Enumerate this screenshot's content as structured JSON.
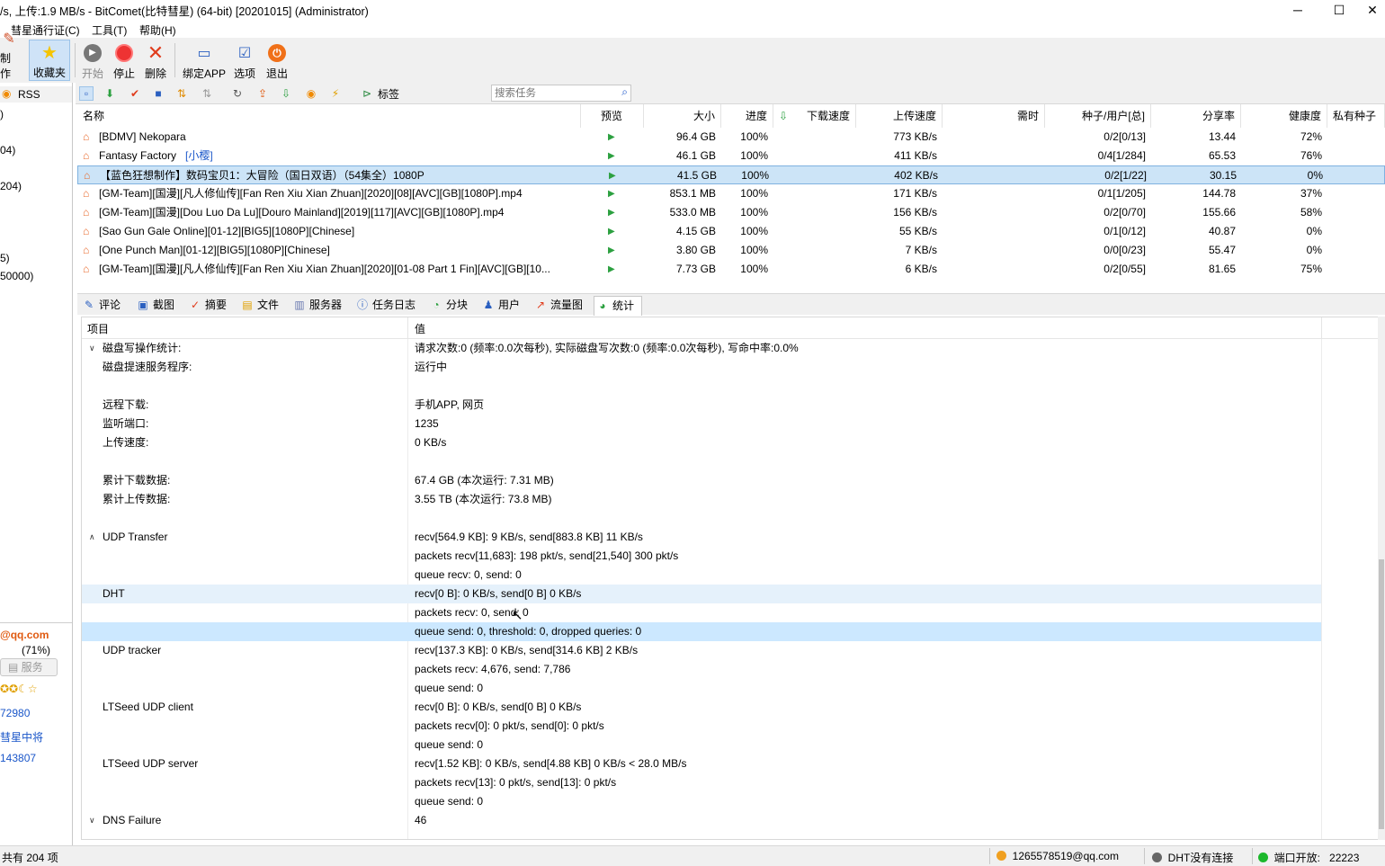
{
  "window": {
    "title": "/s, 上传:1.9 MB/s - BitComet(比特彗星) (64-bit) [20201015] (Administrator)",
    "minimize": "─",
    "maximize": "☐",
    "close": "✕"
  },
  "menu": [
    "彗星通行证(C)",
    "工具(T)",
    "帮助(H)"
  ],
  "toolbar": {
    "make": "制作",
    "favorites": "收藏夹",
    "start": "开始",
    "stop": "停止",
    "delete": "删除",
    "bind_app": "绑定APP",
    "options": "选项",
    "exit": "退出"
  },
  "left": {
    "rss": "RSS",
    "frag1": ")",
    "frag2": "04)",
    "frag3": "204)",
    "frag4": "5)",
    "frag5": "50000)",
    "email": "@qq.com",
    "percent": "(71%)",
    "service": "服务",
    "stars": "✪✪☾☆",
    "num1": "72980",
    "rank": "彗星中将",
    "num2": "143807"
  },
  "toolbar2": {
    "tag_label": "标签",
    "search_placeholder": "搜索任务"
  },
  "columns": [
    "名称",
    "预览",
    "大小",
    "进度",
    "下载速度",
    "上传速度",
    "需时",
    "种子/用户[总]",
    "分享率",
    "健康度",
    "私有种子"
  ],
  "torrents": [
    {
      "name": "[BDMV] Nekopara",
      "tag": "",
      "size": "96.4 GB",
      "progress": "100%",
      "up": "773 KB/s",
      "peers": "0/2[0/13]",
      "ratio": "13.44",
      "health": "72%"
    },
    {
      "name": "Fantasy Factory",
      "tag": "[小樱]",
      "size": "46.1 GB",
      "progress": "100%",
      "up": "411 KB/s",
      "peers": "0/4[1/284]",
      "ratio": "65.53",
      "health": "76%"
    },
    {
      "name": "【蓝色狂想制作】数码宝贝1：大冒险（国日双语）（54集全）1080P",
      "tag": "",
      "size": "41.5 GB",
      "progress": "100%",
      "up": "402 KB/s",
      "peers": "0/2[1/22]",
      "ratio": "30.15",
      "health": "0%"
    },
    {
      "name": "[GM-Team][国漫][凡人修仙传][Fan Ren Xiu Xian Zhuan][2020][08][AVC][GB][1080P].mp4",
      "tag": "",
      "size": "853.1 MB",
      "progress": "100%",
      "up": "171 KB/s",
      "peers": "0/1[1/205]",
      "ratio": "144.78",
      "health": "37%"
    },
    {
      "name": "[GM-Team][国漫][Dou Luo Da Lu][Douro Mainland][2019][117][AVC][GB][1080P].mp4",
      "tag": "",
      "size": "533.0 MB",
      "progress": "100%",
      "up": "156 KB/s",
      "peers": "0/2[0/70]",
      "ratio": "155.66",
      "health": "58%"
    },
    {
      "name": "[Sao Gun Gale Online][01-12][BIG5][1080P][Chinese]",
      "tag": "",
      "size": "4.15 GB",
      "progress": "100%",
      "up": "55 KB/s",
      "peers": "0/1[0/12]",
      "ratio": "40.87",
      "health": "0%"
    },
    {
      "name": "[One Punch Man][01-12][BIG5][1080P][Chinese]",
      "tag": "",
      "size": "3.80 GB",
      "progress": "100%",
      "up": "7 KB/s",
      "peers": "0/0[0/23]",
      "ratio": "55.47",
      "health": "0%"
    },
    {
      "name": "[GM-Team][国漫][凡人修仙传][Fan Ren Xiu Xian Zhuan][2020][01-08 Part 1 Fin][AVC][GB][10...",
      "tag": "",
      "size": "7.73 GB",
      "progress": "100%",
      "up": "6 KB/s",
      "peers": "0/2[0/55]",
      "ratio": "81.65",
      "health": "75%"
    }
  ],
  "tabs": [
    "评论",
    "截图",
    "摘要",
    "文件",
    "服务器",
    "任务日志",
    "分块",
    "用户",
    "流量图",
    "统计"
  ],
  "stats": {
    "header_key": "项目",
    "header_val": "值",
    "rows": [
      {
        "k": "磁盘写操作统计:",
        "v": "请求次数:0 (频率:0.0次每秒), 实际磁盘写次数:0 (频率:0.0次每秒), 写命中率:0.0%"
      },
      {
        "k": "磁盘提速服务程序:",
        "v": "运行中"
      },
      {
        "k": "",
        "v": ""
      },
      {
        "k": "远程下载:",
        "v": "手机APP, 网页"
      },
      {
        "k": "监听端口:",
        "v": "1235"
      },
      {
        "k": "上传速度:",
        "v": "0 KB/s"
      },
      {
        "k": "",
        "v": ""
      },
      {
        "k": "累计下载数据:",
        "v": "67.4 GB (本次运行: 7.31 MB)"
      },
      {
        "k": "累计上传数据:",
        "v": "3.55 TB (本次运行: 73.8 MB)"
      },
      {
        "k": "",
        "v": ""
      },
      {
        "k": "UDP Transfer",
        "v": "recv[564.9 KB]: 9 KB/s, send[883.8 KB] 11 KB/s"
      },
      {
        "k": "",
        "v": "packets recv[11,683]: 198 pkt/s, send[21,540] 300 pkt/s"
      },
      {
        "k": "",
        "v": "queue recv: 0, send: 0"
      },
      {
        "k": "DHT",
        "v": "recv[0 B]: 0 KB/s, send[0 B] 0 KB/s"
      },
      {
        "k": "",
        "v": "packets recv: 0, send: 0"
      },
      {
        "k": "",
        "v": "queue send: 0, threshold: 0, dropped queries: 0"
      },
      {
        "k": "UDP tracker",
        "v": "recv[137.3 KB]: 0 KB/s, send[314.6 KB] 2 KB/s"
      },
      {
        "k": "",
        "v": "packets recv: 4,676, send: 7,786"
      },
      {
        "k": "",
        "v": "queue send: 0"
      },
      {
        "k": "LTSeed UDP client",
        "v": "recv[0 B]: 0 KB/s, send[0 B] 0 KB/s"
      },
      {
        "k": "",
        "v": "packets recv[0]: 0 pkt/s, send[0]: 0 pkt/s"
      },
      {
        "k": "",
        "v": "queue send: 0"
      },
      {
        "k": "LTSeed UDP server",
        "v": "recv[1.52 KB]: 0 KB/s, send[4.88 KB] 0 KB/s < 28.0 MB/s"
      },
      {
        "k": "",
        "v": "packets recv[13]: 0 pkt/s, send[13]: 0 pkt/s"
      },
      {
        "k": "",
        "v": "queue send: 0"
      },
      {
        "k": "DNS Failure",
        "v": "46"
      }
    ]
  },
  "status": {
    "count": "共有 204 项",
    "account": "1265578519@qq.com",
    "dht": "DHT没有连接",
    "port_label": "端口开放:",
    "port": "22223"
  },
  "colors": {
    "selection": "#cce4f7",
    "highlight": "#e5f1fb",
    "icon_orange": "#e9682a",
    "play_green": "#2ca040",
    "link_blue": "#1a56c9"
  }
}
